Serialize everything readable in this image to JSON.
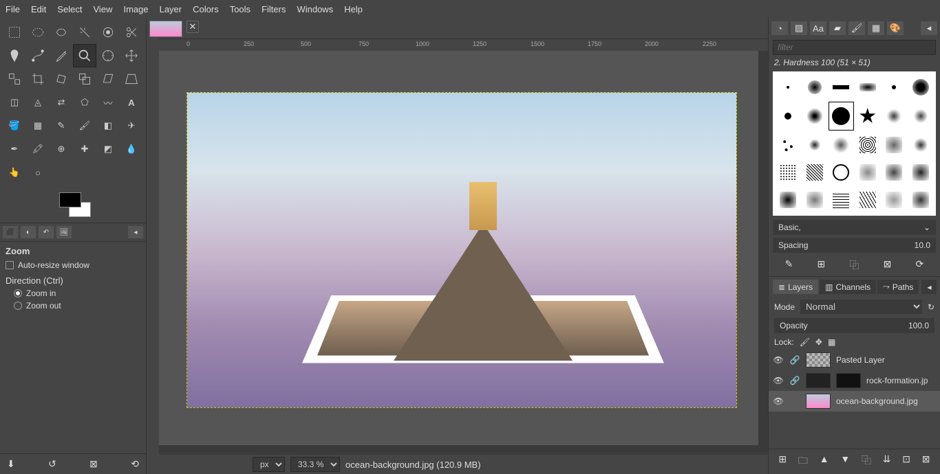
{
  "menu": [
    "File",
    "Edit",
    "Select",
    "View",
    "Image",
    "Layer",
    "Colors",
    "Tools",
    "Filters",
    "Windows",
    "Help"
  ],
  "tool_options": {
    "title": "Zoom",
    "auto_resize": "Auto-resize window",
    "direction_label": "Direction  (Ctrl)",
    "zoom_in": "Zoom in",
    "zoom_out": "Zoom out"
  },
  "status": {
    "unit": "px",
    "zoom": "33.3 %",
    "filename": "ocean-background.jpg (120.9 MB)"
  },
  "ruler_ticks": [
    "0",
    "250",
    "500",
    "750",
    "1000",
    "1250",
    "1500",
    "1750",
    "2000",
    "2250"
  ],
  "brushes": {
    "filter_placeholder": "filter",
    "label": "2. Hardness 100 (51 × 51)",
    "preset": "Basic,",
    "spacing_label": "Spacing",
    "spacing_value": "10.0"
  },
  "layers": {
    "tabs": [
      "Layers",
      "Channels",
      "Paths"
    ],
    "mode_label": "Mode",
    "mode_value": "Normal",
    "opacity_label": "Opacity",
    "opacity_value": "100.0",
    "lock_label": "Lock:",
    "items": [
      {
        "name": "Pasted Layer",
        "visible": true,
        "link": true
      },
      {
        "name": "rock-formation.jp",
        "visible": true,
        "link": true
      },
      {
        "name": "ocean-background.jpg",
        "visible": true,
        "link": false
      }
    ]
  }
}
